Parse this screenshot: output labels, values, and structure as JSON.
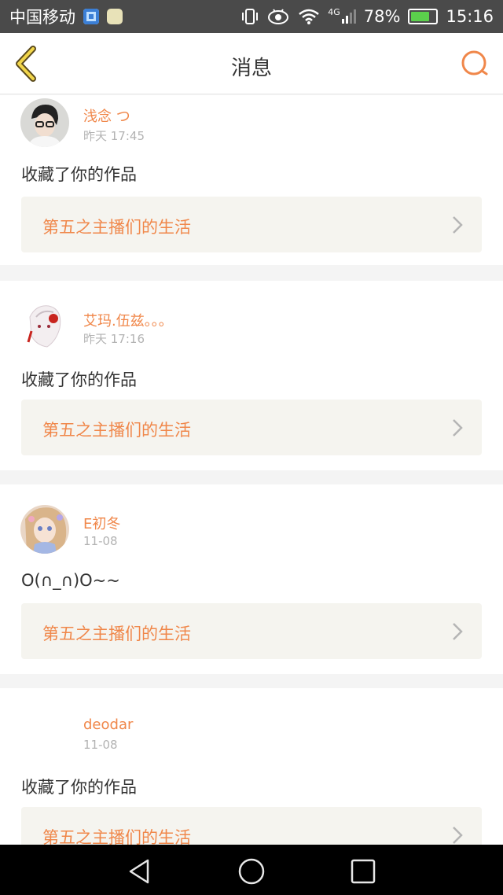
{
  "status_bar": {
    "carrier": "中国移动",
    "network": "4G",
    "battery": "78%",
    "battery_level": 0.78,
    "time": "15:16"
  },
  "header": {
    "title": "消息",
    "back_icon": "back-chevron-icon",
    "search_icon": "search-icon"
  },
  "messages": [
    {
      "user": "浅念 つ",
      "time": "昨天 17:45",
      "text": "收藏了你的作品",
      "work_title": "第五之主播们的生活"
    },
    {
      "user": "艾玛.伍兹。。。",
      "time": "昨天 17:16",
      "text": "收藏了你的作品",
      "work_title": "第五之主播们的生活"
    },
    {
      "user": "E初冬",
      "time": "11-08",
      "text": "O(∩_∩)O~~",
      "work_title": "第五之主播们的生活"
    },
    {
      "user": "deodar",
      "time": "11-08",
      "text": "收藏了你的作品",
      "work_title": "第五之主播们的生活"
    }
  ],
  "colors": {
    "accent": "#f0874a",
    "background": "#f4f4f4",
    "card_box": "#f5f4ef"
  }
}
